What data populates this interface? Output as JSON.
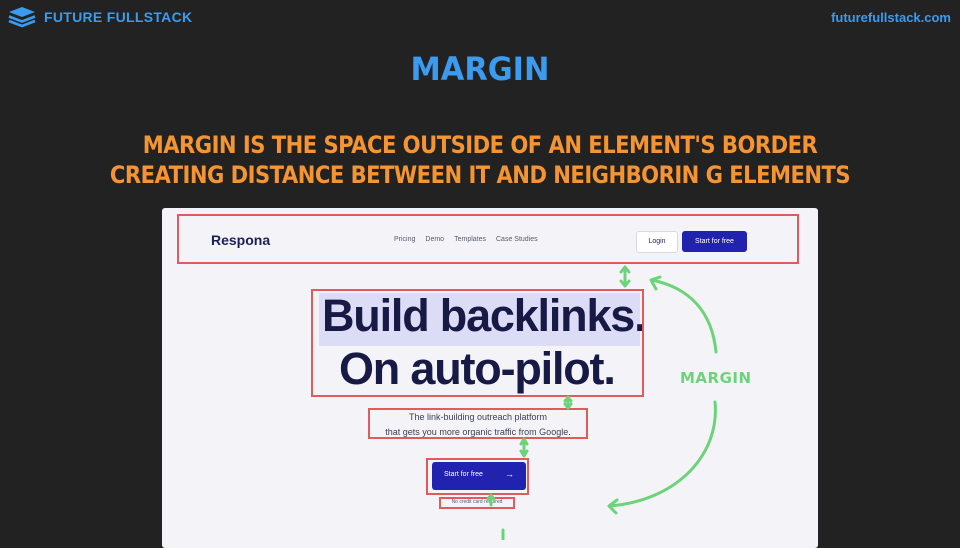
{
  "header": {
    "brand_name": "FUTURE FULLSTACK",
    "site_url": "futurefullstack.com",
    "logo_icon": "layers-stack-icon"
  },
  "slide": {
    "title": "MARGIN",
    "subtitle_line1": "MARGIN IS THE SPACE OUTSIDE OF AN ELEMENT'S BORDER",
    "subtitle_line2": "CREATING DISTANCE BETWEEN IT AND NEIGHBORIN G ELEMENTS",
    "margin_annotation": "MARGIN"
  },
  "screenshot": {
    "logo": "Respona",
    "nav_links": [
      "Pricing",
      "Demo",
      "Templates",
      "Case Studies"
    ],
    "login": "Login",
    "start_free": "Start for free",
    "hero_line1": "Build backlinks.",
    "hero_line2": "On auto-pilot.",
    "tagline_line1": "The link-building outreach platform",
    "tagline_line2": "that gets you more organic traffic from Google.",
    "cta": "Start for free",
    "cta_arrow": "→",
    "no_cc": "No credit card required"
  },
  "colors": {
    "background": "#222222",
    "title_blue": "#3b9bf0",
    "subtitle_orange": "#f59432",
    "highlight_red": "#e05a5e",
    "annotation_green": "#6dd37a",
    "button_blue": "#2222b0"
  }
}
